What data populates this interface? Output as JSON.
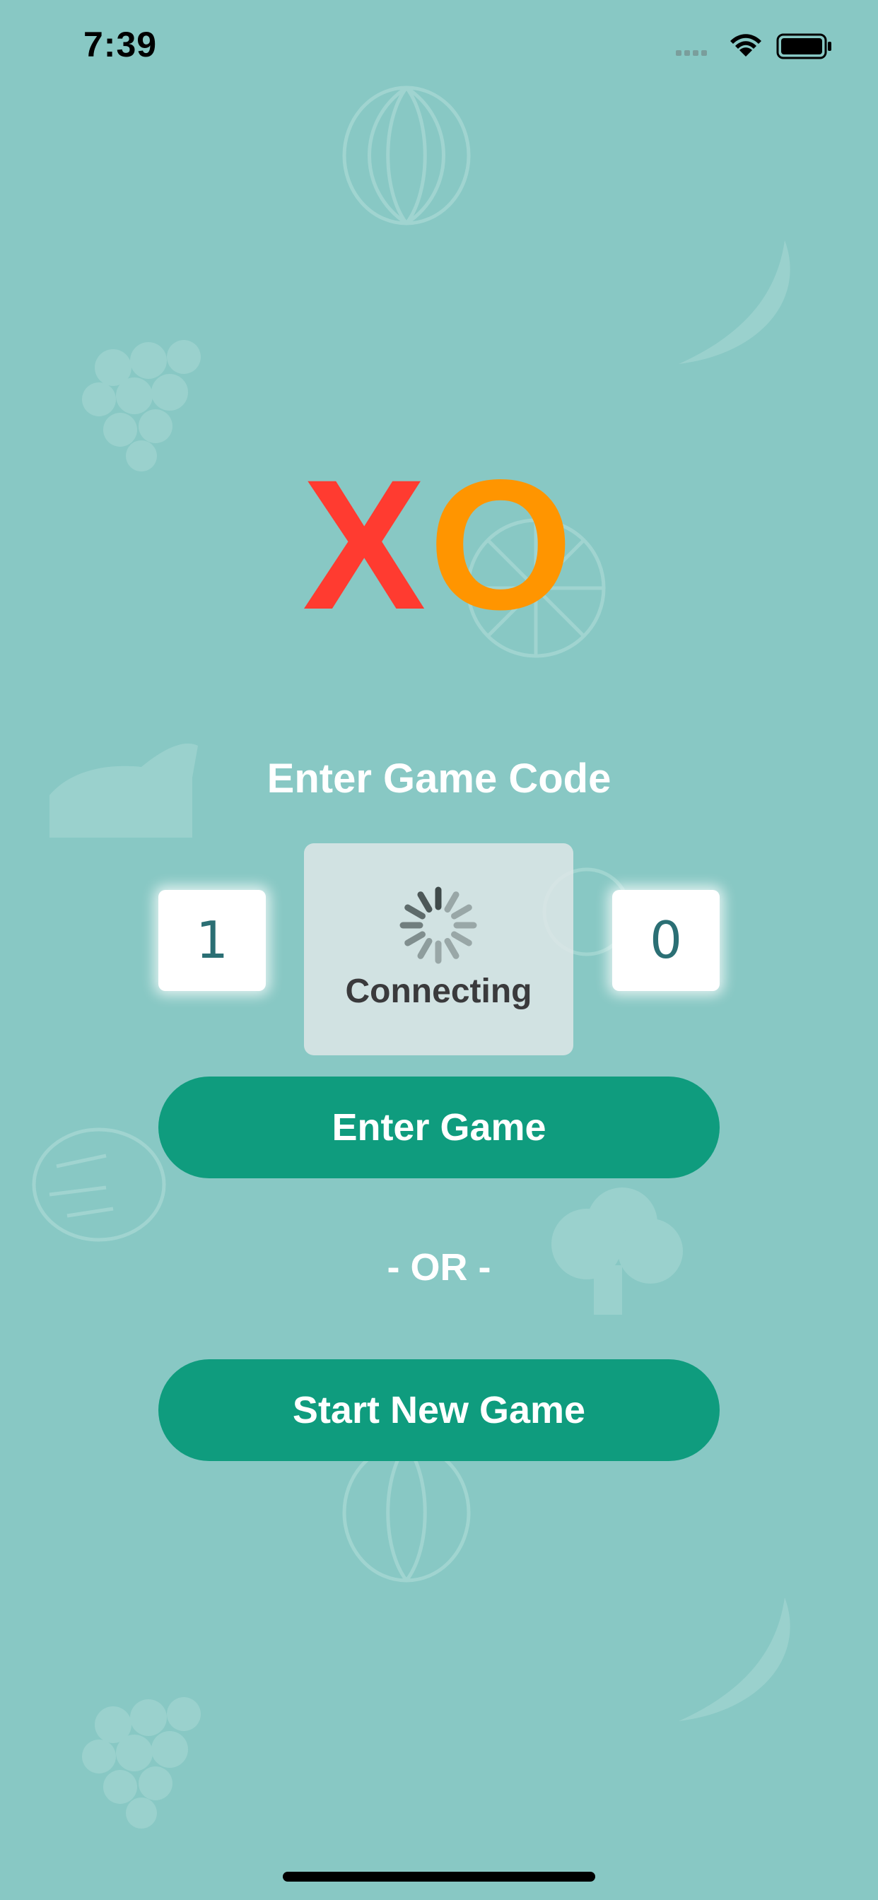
{
  "status_bar": {
    "time": "7:39",
    "icons": [
      "signal-icon",
      "wifi-icon",
      "battery-icon"
    ]
  },
  "logo": {
    "x_letter": "X",
    "o_letter": "O",
    "x_color": "#ff3b30",
    "o_color": "#ff9500"
  },
  "join_section": {
    "heading": "Enter Game Code",
    "code_digits": [
      "1",
      "0"
    ],
    "enter_button_label": "Enter Game"
  },
  "loading_hud": {
    "label": "Connecting",
    "icon": "spinner-icon"
  },
  "divider": {
    "text": "- OR -"
  },
  "new_game": {
    "button_label": "Start New Game"
  },
  "colors": {
    "background": "#88c8c4",
    "button": "#0f9c7e",
    "digit_text": "#2b6f74"
  }
}
